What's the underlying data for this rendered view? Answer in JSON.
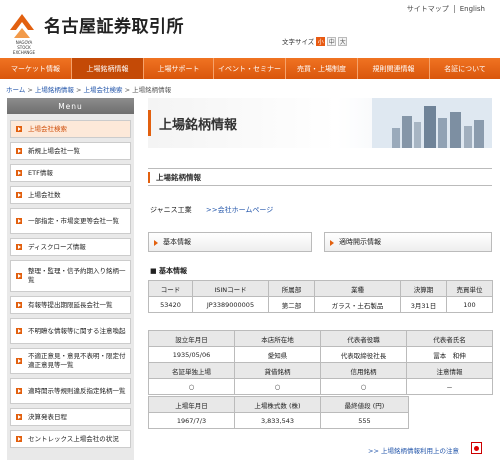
{
  "header": {
    "logo_text": "名古屋証券取引所",
    "logo_sub_line1": "NAGOYA",
    "logo_sub_line2": "STOCK EXCHANGE",
    "sitemap": "サイトマップ",
    "english": "English",
    "font_size_label": "文字サイズ",
    "font_sizes": [
      "小",
      "中",
      "大"
    ]
  },
  "nav": {
    "items": [
      "マーケット情報",
      "上場銘柄情報",
      "上場サポート",
      "イベント・セミナー",
      "売買・上場制度",
      "規則関連情報",
      "名証について"
    ]
  },
  "breadcrumb": {
    "home": "ホーム",
    "level1": "上場銘柄情報",
    "level2": "上場会社検索",
    "current": "上場銘柄情報",
    "sep": ">"
  },
  "sidebar": {
    "title": "Menu",
    "items": [
      "上場会社検索",
      "新規上場会社一覧",
      "ETF情報",
      "上場会社数",
      "一部指定・市場変更等会社一覧",
      "ディスクローズ情報",
      "整理・監理・信予約期入り銘柄一覧",
      "有報等提出期限延長会社一覧",
      "不明瞭な情報等に関する注意喚起",
      "不適正意見・意見不表明・限定付適正意見等一覧",
      "適時開示等規則違反指定銘柄一覧",
      "決算発表日程",
      "セントレックス上場会社の状況"
    ]
  },
  "main": {
    "banner_title": "上場銘柄情報",
    "section_title": "上場銘柄情報",
    "company_name": "ジャニス工業",
    "company_link": ">>会社ホームページ",
    "tab_basic": "基本情報",
    "tab_disclosure": "適時開示情報",
    "basic_label": "■ 基本情報",
    "table1": {
      "headers": [
        "コード",
        "ISINコード",
        "所属部",
        "業種",
        "決算期",
        "売買単位"
      ],
      "values": [
        "53420",
        "JP3389000005",
        "第二部",
        "ガラス・土石製品",
        "3月31日",
        "100"
      ]
    },
    "table2": {
      "headers": [
        "設立年月日",
        "本店所在地",
        "代表者役職",
        "代表者氏名"
      ],
      "values": [
        "1935/05/06",
        "愛知県",
        "代表取締役社長",
        "冨本　和伸"
      ]
    },
    "table3": {
      "headers": [
        "名証単独上場",
        "貸借銘柄",
        "信用銘柄",
        "注意情報"
      ],
      "values": [
        "○",
        "○",
        "○",
        "－"
      ]
    },
    "table4": {
      "headers": [
        "上場年月日",
        "上場株式数 (株)",
        "最終値段 (円)"
      ],
      "values": [
        "1967/7/3",
        "3,833,543",
        "555"
      ]
    },
    "notice": ">> 上場銘柄情報利用上の注意"
  }
}
